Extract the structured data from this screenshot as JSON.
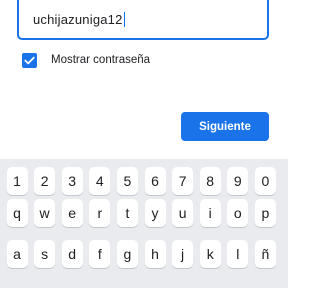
{
  "password_field": {
    "value": "uchijazuniga12"
  },
  "show_password": {
    "label": "Mostrar contraseña",
    "checked": true
  },
  "next_button": {
    "label": "Siguiente"
  },
  "keyboard": {
    "rows": [
      [
        "1",
        "2",
        "3",
        "4",
        "5",
        "6",
        "7",
        "8",
        "9",
        "0"
      ],
      [
        "q",
        "w",
        "e",
        "r",
        "t",
        "y",
        "u",
        "i",
        "o",
        "p"
      ],
      [
        "a",
        "s",
        "d",
        "f",
        "g",
        "h",
        "j",
        "k",
        "l",
        "ñ"
      ]
    ]
  },
  "colors": {
    "accent": "#1a73e8",
    "keyboard_bg": "#e9ebee"
  }
}
